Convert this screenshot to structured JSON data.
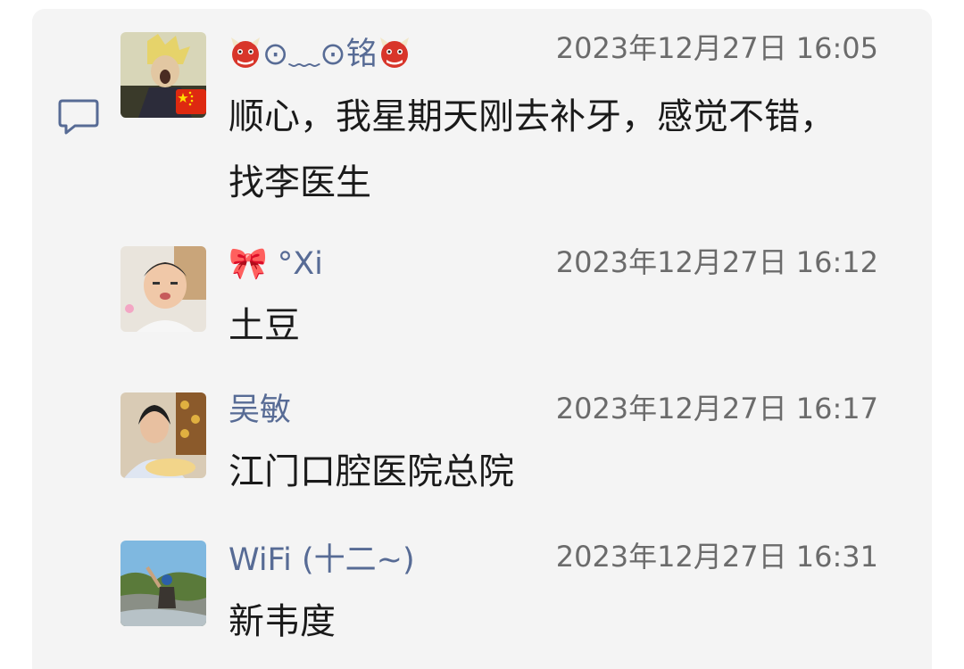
{
  "comments": [
    {
      "name_prefix_icon": "ogre-face-icon",
      "name": "⊙﹏⊙铭",
      "name_suffix_icon": "ogre-face-icon",
      "time": "2023年12月27日 16:05",
      "text": "顺心，我星期天刚去补牙，感觉不错，找李医生",
      "avatar": "anime-character-avatar",
      "badge": "china-flag-icon"
    },
    {
      "name": "🎀 °Xi",
      "time": "2023年12月27日 16:12",
      "text": "土豆",
      "avatar": "child-photo-avatar"
    },
    {
      "name": "吴敏",
      "time": "2023年12月27日 16:17",
      "text": "江门口腔医院总院",
      "avatar": "woman-photo-avatar"
    },
    {
      "name": "WiFi (十二~)",
      "time": "2023年12月27日 16:31",
      "text": "新韦度",
      "avatar": "mountain-photo-avatar"
    }
  ],
  "colors": {
    "name": "#576b95",
    "time": "#6b6b6b",
    "text": "#1a1a1a",
    "panel": "#f4f4f4"
  }
}
